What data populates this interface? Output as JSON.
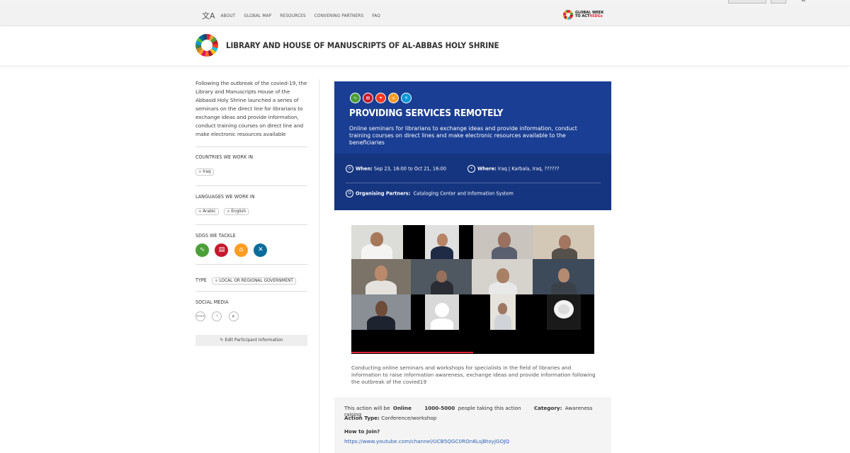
{
  "nav": {
    "items": [
      "ABOUT",
      "GLOBAL MAP",
      "RESOURCES",
      "CONVENING PARTNERS",
      "FAQ"
    ],
    "logo_text_1": "GLOBAL",
    "logo_text_2": "WEEK",
    "logo_text_3": "TO ACT",
    "logo_text_4": "4SDGs"
  },
  "header": {
    "title": "LIBRARY AND HOUSE OF MANUSCRIPTS OF AL-ABBAS HOLY SHRINE"
  },
  "sidebar": {
    "intro": "Following the outbreak of the covied-19, the Library and Manuscripts House of the Abbasid Holy Shrine launched a series of seminars on the direct line for librarians to exchange ideas and provide information, conduct training courses on direct line and make electronic resources available",
    "countries_title": "COUNTRIES WE WORK IN",
    "countries": [
      "Iraq"
    ],
    "languages_title": "LANGUAGES WE WORK IN",
    "languages": [
      "Arabic",
      "English"
    ],
    "sdgs_title": "SDGS WE TACKLE",
    "sdg_colors": [
      "#4c9f38",
      "#c5192d",
      "#fd9d24",
      "#0a6c9c"
    ],
    "sdg_icons": [
      "heartbeat-icon",
      "book-icon",
      "equality-icon",
      "handshake-icon"
    ],
    "type_title": "TYPE",
    "type_value": "LOCAL OR REGIONAL GOVERNMENT",
    "social_title": "SOCIAL MEDIA",
    "social_icons": [
      "www-icon",
      "facebook-icon",
      "youtube-icon"
    ],
    "edit_label": "Edit Participant Information"
  },
  "card": {
    "sdg_colors": [
      "#4c9f38",
      "#c5192d",
      "#ff3a21",
      "#fd9d24",
      "#0a97d9"
    ],
    "title": "PROVIDING SERVICES REMOTELY",
    "description": "Online seminars for librarians to exchange ideas and provide information, conduct training courses on direct lines and make electronic resources available to the beneficiaries",
    "when_label": "When:",
    "when_value": "Sep 23, 16:00 to Oct 21, 16:00",
    "where_label": "Where:",
    "where_value": "Iraq | Karbala, Iraq, ??????",
    "partners_label": "Organising Partners:",
    "partners_value": "Cataloging Center and Information System"
  },
  "caption": "Conducting online seminars and workshops for specialists in the field of libraries and information to raise information awareness, exchange ideas and provide information following the outbreak of the covied19",
  "info": {
    "online_prefix": "This action will be",
    "online_value": "Online",
    "people_range": "1000-5000",
    "people_suffix": "people taking this action",
    "category_label": "Category:",
    "category_value": "Awareness raising",
    "action_type_label": "Action Type:",
    "action_type_value": "Conference/workshop",
    "how_to_join_label": "How to Join?",
    "join_link": "https://www.youtube.com/channel/UCB5QGC0ROn6LsjBtoyjGOJQ"
  }
}
